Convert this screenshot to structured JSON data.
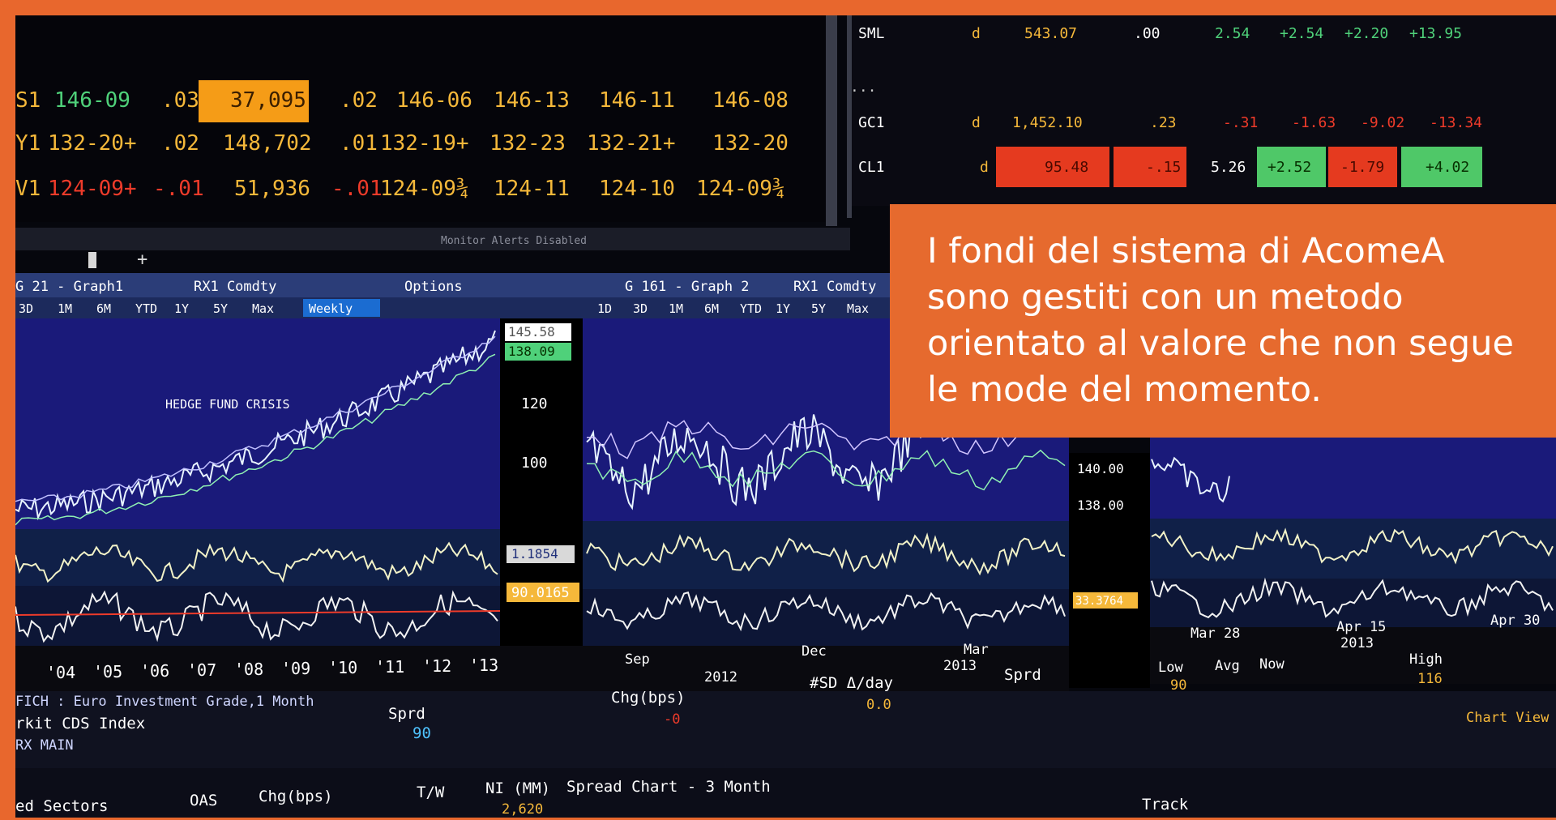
{
  "overlay_text": "I fondi del sistema di AcomeA sono gestiti con un metodo orientato al valore che non segue le mode del momento.",
  "colors": {
    "frame": "#e8672d",
    "overlay": "#e66a2e",
    "chart_bg": "#1a1a7a",
    "amber": "#f5b83a",
    "green": "#4fd17a",
    "red": "#ee3b2a"
  },
  "left_table": {
    "rows": [
      [
        "S1",
        "146-09",
        ".03",
        "37,095",
        ".02",
        "146-06",
        "146-13",
        "146-11",
        "146-08"
      ],
      [
        "Y1",
        "132-20+",
        ".02",
        "148,702",
        ".01",
        "132-19+",
        "132-23",
        "132-21+",
        "132-20"
      ],
      [
        "V1",
        "124-09+",
        "-.01",
        "51,936",
        "-.01",
        "124-09¾",
        "124-11",
        "124-10",
        "124-09¾"
      ]
    ],
    "status": "Monitor Alerts Disabled"
  },
  "right_table": {
    "rows": [
      [
        "SML",
        "d",
        "543.07",
        ".00",
        "2.54",
        "+2.54",
        "+2.20",
        "+13.95"
      ],
      [
        "GC1",
        "d",
        "1,452.10",
        ".23",
        "-.31",
        "-1.63",
        "-9.02",
        "-13.34"
      ],
      [
        "CL1",
        "d",
        "95.48",
        "-.15",
        "5.26",
        "+2.52",
        "-1.79",
        "+4.02"
      ]
    ],
    "ellipsis": "..."
  },
  "graph1": {
    "title": "G 21 - Graph1",
    "ticker": "RX1 Comdty",
    "options": "Options",
    "periods": [
      "3D",
      "1M",
      "6M",
      "YTD",
      "1Y",
      "5Y",
      "Max"
    ],
    "interval": "Weekly",
    "annotation": "HEDGE FUND CRISIS",
    "price_labels": [
      "145.58",
      "138.09"
    ],
    "ticks": [
      "120",
      "100"
    ],
    "ind1": "1.1854",
    "ind2": "90.0165",
    "years": [
      "'04",
      "'05",
      "'06",
      "'07",
      "'08",
      "'09",
      "'10",
      "'11",
      "'12",
      "'13"
    ]
  },
  "graph2": {
    "title": "G 161 - Graph 2",
    "ticker": "RX1 Comdty",
    "periods": [
      "1D",
      "3D",
      "1M",
      "6M",
      "YTD",
      "1Y",
      "5Y",
      "Max"
    ],
    "price_labels": [
      "140.00",
      "138.00"
    ],
    "ind": "33.3764",
    "dates": [
      "Sep",
      "2012",
      "Dec",
      "Mar",
      "2013"
    ]
  },
  "graph3": {
    "dates": [
      "Mar 28",
      "Apr 15",
      "2013",
      "Apr 30"
    ]
  },
  "cds": {
    "title": "FICH : Euro Investment Grade,1 Month",
    "line2": "rkit CDS Index",
    "line3": "RX MAIN",
    "sprd_label": "Sprd",
    "sprd_value": "90",
    "chg_label": "Chg(bps)",
    "chg_value": "-0",
    "sd_label": "#SD Δ/day",
    "sd_value": "0.0",
    "sprd2": "Sprd",
    "low_label": "Low",
    "low_value": "90",
    "avg": "Avg",
    "now": "Now",
    "high_label": "High",
    "high_value": "116",
    "chart_view": "Chart View"
  },
  "bottom": {
    "sectors": "ed Sectors",
    "oas": "OAS",
    "chg": "Chg(bps)",
    "tw": "T/W",
    "ni": "NI (MM)",
    "ni_value": "2,620",
    "spread_chart": "Spread Chart - 3 Month",
    "track": "Track"
  }
}
